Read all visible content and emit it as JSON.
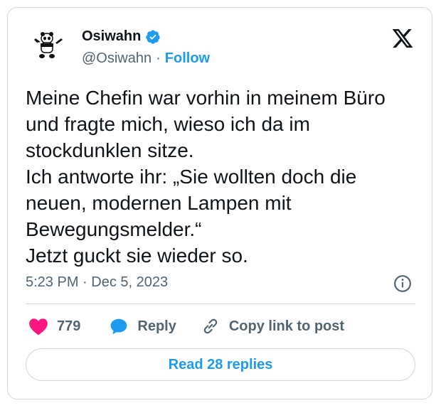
{
  "author": {
    "display_name": "Osiwahn",
    "handle": "@Osiwahn",
    "separator": "·",
    "follow_label": "Follow",
    "verified_color": "#1d9bf0"
  },
  "post": {
    "lines": [
      "Meine Chefin war vorhin in meinem Büro",
      "und fragte mich, wieso ich da im",
      "stockdunklen sitze.",
      "Ich antworte ihr: „Sie wollten doch die",
      "neuen, modernen Lampen mit",
      "Bewegungsmelder.“",
      "Jetzt guckt sie wieder so."
    ],
    "timestamp": "5:23 PM · Dec 5, 2023"
  },
  "actions": {
    "likes": "779",
    "reply_label": "Reply",
    "copy_label": "Copy link to post"
  },
  "read_replies_label": "Read 28 replies",
  "colors": {
    "accent": "#1d9bf0",
    "heart": "#f91880",
    "muted": "#536471",
    "text": "#0f1419"
  }
}
